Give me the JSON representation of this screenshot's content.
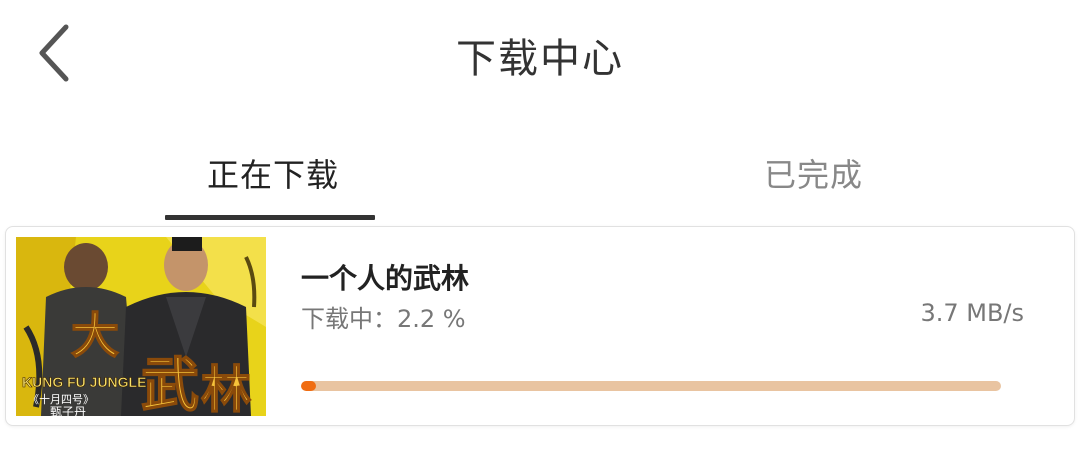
{
  "header": {
    "title": "下载中心",
    "back_icon": "chevron-left-icon"
  },
  "tabs": [
    {
      "label": "正在下载",
      "active": true
    },
    {
      "label": "已完成",
      "active": false
    }
  ],
  "downloads": [
    {
      "title": "一个人的武林",
      "status_label": "下载中：",
      "progress_text": "2.2 %",
      "progress": 0.022,
      "speed": "3.7 MB/s",
      "poster": {
        "name": "movie-poster",
        "title_en": "KUNG FU JUNGLE",
        "date_text": "《十月四号》",
        "actor_text": "甄子丹"
      }
    }
  ],
  "colors": {
    "progress_fill": "#f06d12",
    "progress_track": "#e9c4a1",
    "active_tab": "#222222",
    "inactive_tab": "#888888"
  }
}
